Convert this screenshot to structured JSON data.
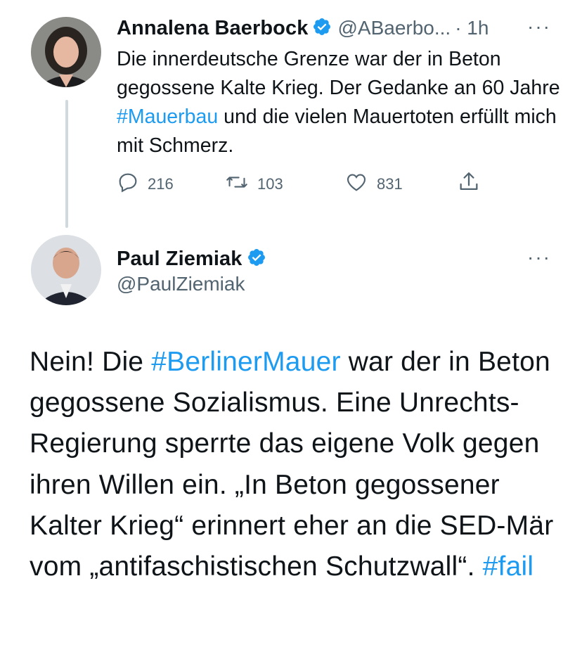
{
  "tweet1": {
    "author_name": "Annalena Baerbock",
    "handle": "@ABaerbo...",
    "time": "· 1h",
    "more": "···",
    "text_parts": [
      "Die innerdeutsche Grenze war der in Beton gegossene Kalte Krieg. Der Gedanke an 60 Jahre ",
      "#Mauerbau",
      " und die vielen Mauertoten erfüllt mich mit Schmerz."
    ],
    "actions": {
      "replies": "216",
      "retweets": "103",
      "likes": "831"
    }
  },
  "tweet2": {
    "author_name": "Paul Ziemiak",
    "handle": "@PaulZiemiak",
    "more": "···",
    "text_parts": [
      "Nein! Die ",
      "#BerlinerMauer",
      " war der in Beton gegossene Sozialismus. Eine Unrechts-Regierung sperrte das eigene Volk gegen ihren Willen ein. „In Beton gegossener Kalter Krieg“ erinnert eher an die SED-Mär vom „antifaschistischen Schutzwall“. ",
      "#fail"
    ]
  },
  "colors": {
    "link": "#1d9bf0",
    "secondary": "#536471",
    "text": "#0f1419",
    "thread_line": "#cfd9de",
    "verified": "#1d9bf0"
  },
  "icons": [
    "reply-icon",
    "retweet-icon",
    "like-icon",
    "share-icon",
    "verified-badge-icon",
    "more-icon"
  ]
}
